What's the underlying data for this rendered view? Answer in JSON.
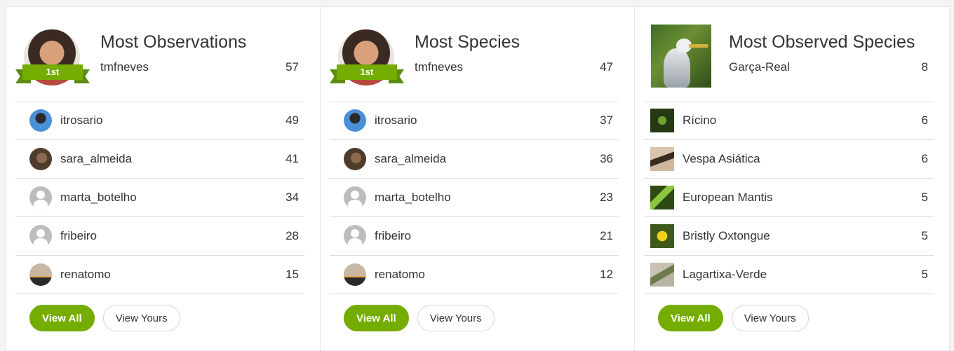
{
  "panels": [
    {
      "title": "Most Observations",
      "badge": "1st",
      "top": {
        "name": "tmfneves",
        "count": "57"
      },
      "rows": [
        {
          "name": "itrosario",
          "count": "49",
          "icon": "avatar-itrosario"
        },
        {
          "name": "sara_almeida",
          "count": "41",
          "icon": "avatar-sara-almeida"
        },
        {
          "name": "marta_botelho",
          "count": "34",
          "icon": "default-user-icon"
        },
        {
          "name": "fribeiro",
          "count": "28",
          "icon": "default-user-icon"
        },
        {
          "name": "renatomo",
          "count": "15",
          "icon": "avatar-renatomo"
        }
      ],
      "buttons": {
        "view_all": "View All",
        "view_yours": "View Yours"
      }
    },
    {
      "title": "Most Species",
      "badge": "1st",
      "top": {
        "name": "tmfneves",
        "count": "47"
      },
      "rows": [
        {
          "name": "itrosario",
          "count": "37",
          "icon": "avatar-itrosario"
        },
        {
          "name": "sara_almeida",
          "count": "36",
          "icon": "avatar-sara-almeida"
        },
        {
          "name": "marta_botelho",
          "count": "23",
          "icon": "default-user-icon"
        },
        {
          "name": "fribeiro",
          "count": "21",
          "icon": "default-user-icon"
        },
        {
          "name": "renatomo",
          "count": "12",
          "icon": "avatar-renatomo"
        }
      ],
      "buttons": {
        "view_all": "View All",
        "view_yours": "View Yours"
      }
    },
    {
      "title": "Most Observed Species",
      "top": {
        "name": "Garça-Real",
        "count": "8"
      },
      "rows": [
        {
          "name": "Rícino",
          "count": "6",
          "icon": "ricino-photo"
        },
        {
          "name": "Vespa Asiática",
          "count": "6",
          "icon": "vespa-photo"
        },
        {
          "name": "European Mantis",
          "count": "5",
          "icon": "mantis-photo"
        },
        {
          "name": "Bristly Oxtongue",
          "count": "5",
          "icon": "oxtongue-photo"
        },
        {
          "name": "Lagartixa-Verde",
          "count": "5",
          "icon": "lagartixa-photo"
        }
      ],
      "buttons": {
        "view_all": "View All",
        "view_yours": "View Yours"
      }
    }
  ],
  "colors": {
    "accent": "#74ac00",
    "ribbon_dark": "#5d8c12",
    "divider": "#dcdcdc"
  }
}
